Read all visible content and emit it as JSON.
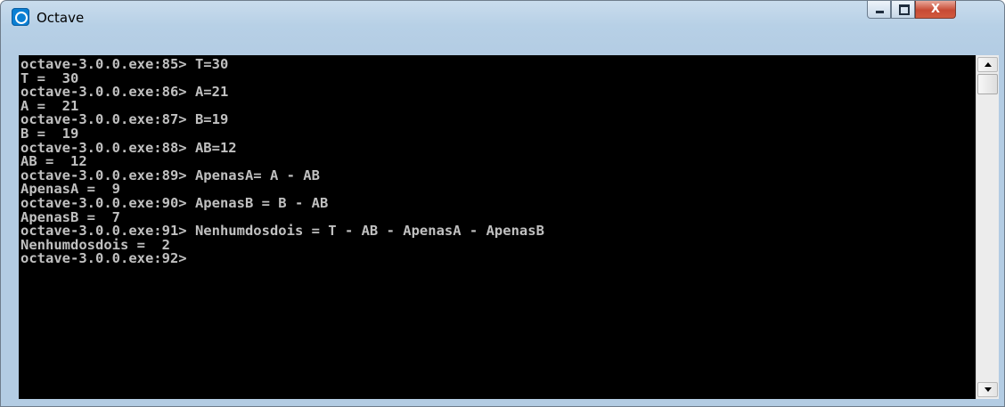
{
  "window": {
    "title": "Octave",
    "icon": "octave-app-icon",
    "controls": {
      "minimize_icon": "minimize-icon",
      "maximize_icon": "maximize-icon",
      "close_glyph": "X"
    }
  },
  "console": {
    "background": "#000000",
    "text_color": "#c0c0c0",
    "lines": [
      "octave-3.0.0.exe:85> T=30",
      "T =  30",
      "octave-3.0.0.exe:86> A=21",
      "A =  21",
      "octave-3.0.0.exe:87> B=19",
      "B =  19",
      "octave-3.0.0.exe:88> AB=12",
      "AB =  12",
      "octave-3.0.0.exe:89> ApenasA= A - AB",
      "ApenasA =  9",
      "octave-3.0.0.exe:90> ApenasB = B - AB",
      "ApenasB =  7",
      "octave-3.0.0.exe:91> Nenhumdosdois = T - AB - ApenasA - ApenasB",
      "Nenhumdosdois =  2",
      "octave-3.0.0.exe:92>"
    ]
  },
  "scrollbar": {
    "up_icon": "scroll-up-arrow-icon",
    "down_icon": "scroll-down-arrow-icon"
  }
}
